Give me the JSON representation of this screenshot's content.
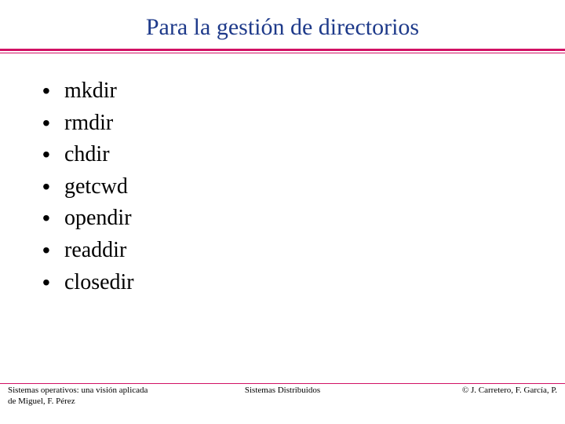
{
  "title": "Para la gestión de directorios",
  "bullets": [
    "mkdir",
    "rmdir",
    "chdir",
    "getcwd",
    "opendir",
    "readdir",
    "closedir"
  ],
  "footer": {
    "left_line1": "Sistemas operativos: una visión aplicada",
    "left_line2": "de Miguel, F. Pérez",
    "center": "Sistemas Distribuidos",
    "right": "© J. Carretero, F. García, P."
  }
}
